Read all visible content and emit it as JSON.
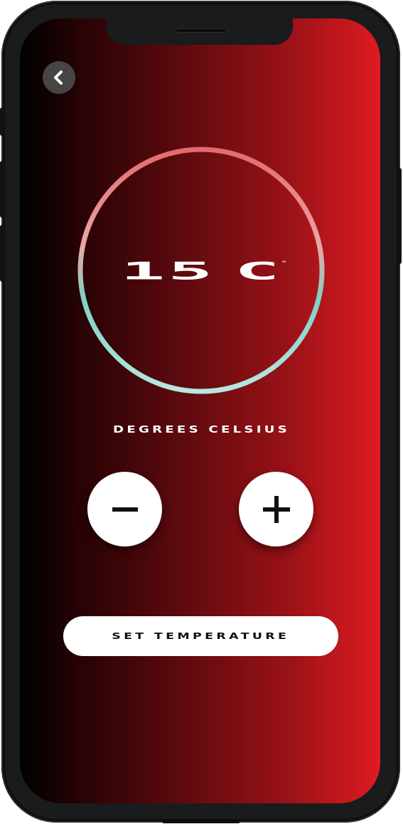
{
  "app": {
    "screen": "temperature-setter"
  },
  "nav": {
    "back_icon": "chevron-left-icon"
  },
  "dial": {
    "value": "15",
    "unit_symbol": "C",
    "degree_symbol": "°",
    "ring_gradient_top": "#e67a7c",
    "ring_gradient_bottom": "#86d3c9"
  },
  "label": {
    "unit_text": "DEGREES CELSIUS"
  },
  "controls": {
    "decrease_icon": "minus-icon",
    "increase_icon": "plus-icon"
  },
  "actions": {
    "set_label": "SET TEMPERATURE"
  },
  "colors": {
    "background_start": "#000000",
    "background_end": "#e01b22",
    "button_bg": "#ffffff",
    "button_fg": "#111111"
  }
}
